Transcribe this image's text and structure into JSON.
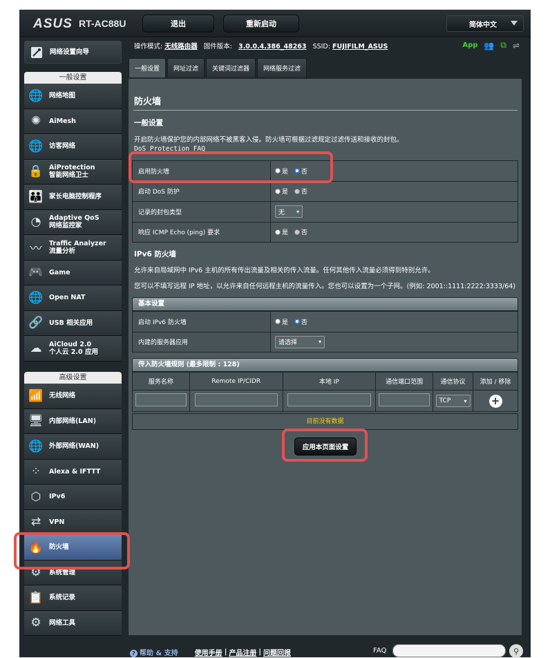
{
  "header": {
    "logo": "ASUS",
    "model": "RT-AC88U",
    "logout_label": "退出",
    "reboot_label": "重新启动",
    "language": "简体中文"
  },
  "status": {
    "mode_label": "操作模式:",
    "mode_value": "无线路由器",
    "firmware_label": "固件版本:",
    "firmware_value": "3.0.0.4.386_48263",
    "ssid_label": "SSID:",
    "ssid_value": "FUJIFILM_ASUS",
    "app_label": "App"
  },
  "nav": {
    "qis_label": "网络设置向导",
    "general_header": "一般设置",
    "general_items": [
      {
        "l1": "网络地图",
        "l2": ""
      },
      {
        "l1": "AiMesh",
        "l2": ""
      },
      {
        "l1": "访客网络",
        "l2": ""
      },
      {
        "l1": "AiProtection",
        "l2": "智能网络卫士"
      },
      {
        "l1": "家长电脑控制程序",
        "l2": ""
      },
      {
        "l1": "Adaptive QoS",
        "l2": "网络监控家"
      },
      {
        "l1": "Traffic Analyzer",
        "l2": "流量分析"
      },
      {
        "l1": "Game",
        "l2": ""
      },
      {
        "l1": "Open NAT",
        "l2": ""
      },
      {
        "l1": "USB 相关应用",
        "l2": ""
      },
      {
        "l1": "AiCloud 2.0",
        "l2": "个人云 2.0 应用"
      }
    ],
    "advanced_header": "高级设置",
    "advanced_items": [
      {
        "l1": "无线网络"
      },
      {
        "l1": "内部网络(LAN)"
      },
      {
        "l1": "外部网络(WAN)"
      },
      {
        "l1": "Alexa & IFTTT"
      },
      {
        "l1": "IPv6"
      },
      {
        "l1": "VPN"
      },
      {
        "l1": "防火墙"
      },
      {
        "l1": "系统管理"
      },
      {
        "l1": "系统记录"
      },
      {
        "l1": "网络工具"
      }
    ]
  },
  "tabs": [
    "一般设置",
    "网址过滤",
    "关键词过滤器",
    "网络服务过滤"
  ],
  "page": {
    "title": "防火墙",
    "general_title": "一般设置",
    "general_desc": "开启防火墙保护您的内部网络不被黑客入侵。防火墙可根据过滤规定过滤传送和接收的封包。",
    "faq_link": "DoS Protection FAQ",
    "rows": {
      "enable_fw": "启用防火墙",
      "enable_dos": "启动 DoS 防护",
      "log_type": "记录的封包类型",
      "log_type_value": "无",
      "icmp": "响应 ICMP Echo (ping) 要求"
    },
    "yes": "是",
    "no": "否",
    "ipv6_title": "IPv6 防火墙",
    "ipv6_desc1": "允许来自局域网中 IPv6 主机的所有传出流量及相关的传入流量。任何其他传入流量必须得到特别允许。",
    "ipv6_desc2": "您可以不填写远程 IP 地址，以允许来自任何远程主机的流量传入。您也可以设置为一个子网。(例如: 2001::1111:2222:3333/64)",
    "basic_bar": "基本设置",
    "ipv6_enable": "启动 IPv6 防火墙",
    "builtin_apps": "内建的服务器应用",
    "builtin_value": "请选择",
    "rules_bar": "传入防火墙规则 (最多限制 : 128)",
    "cols": [
      "服务名称",
      "Remote IP/CIDR",
      "本地 IP",
      "通信端口范围",
      "通信协议",
      "添加 / 移除"
    ],
    "proto_value": "TCP",
    "no_data": "目前没有数据",
    "apply": "应用本页面设置"
  },
  "footer": {
    "help": "帮助 & 支持",
    "manual": "使用手册",
    "register": "产品注册",
    "feedback": "问题回报",
    "faq": "FAQ"
  }
}
